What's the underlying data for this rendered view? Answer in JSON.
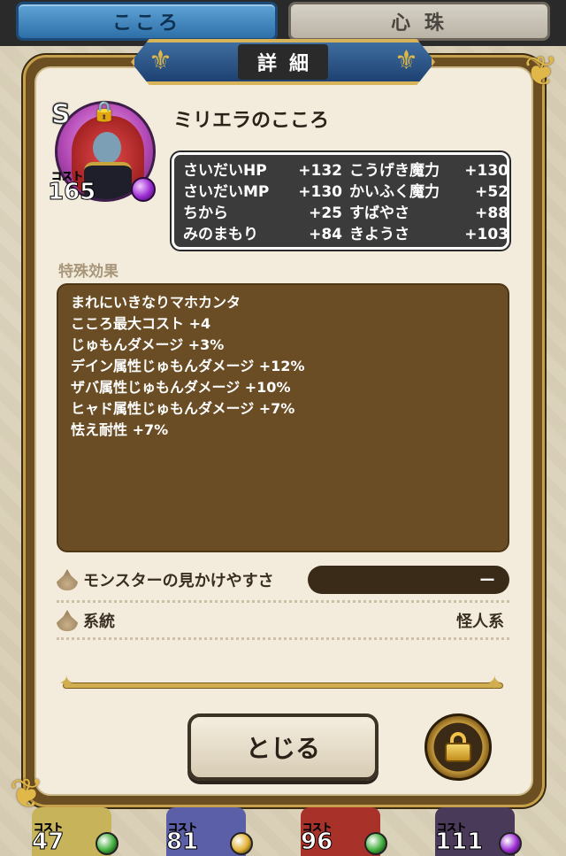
{
  "tabs": [
    {
      "label": "こころ",
      "active": true
    },
    {
      "label": "心 珠",
      "active": false
    }
  ],
  "dialog": {
    "title": "詳細",
    "heart_name": "ミリエラのこころ",
    "rank": "S",
    "cost_label": "コスト",
    "cost_value": "165",
    "stats": [
      {
        "label": "さいだいHP",
        "value": "+132"
      },
      {
        "label": "こうげき魔力",
        "value": "+130"
      },
      {
        "label": "さいだいMP",
        "value": "+130"
      },
      {
        "label": "かいふく魔力",
        "value": "+52"
      },
      {
        "label": "ちから",
        "value": "+25"
      },
      {
        "label": "すばやさ",
        "value": "+88"
      },
      {
        "label": "みのまもり",
        "value": "+84"
      },
      {
        "label": "きようさ",
        "value": "+103"
      }
    ],
    "special_label": "特殊効果",
    "effects": [
      "まれにいきなりマホカンタ",
      "こころ最大コスト +4",
      "じゅもんダメージ +3%",
      "デイン属性じゅもんダメージ +12%",
      "ザバ属性じゅもんダメージ +10%",
      "ヒャド属性じゅもんダメージ +7%",
      "怯え耐性 +7%"
    ],
    "visibility_label": "モンスターの見かけやすさ",
    "visibility_value": "ー",
    "family_label": "系統",
    "family_value": "怪人系",
    "close_label": "とじる"
  },
  "bottom_cards": [
    {
      "cost_label": "コスト",
      "cost": "47",
      "orb_color": "#3fae3a",
      "bg_color": "#c7b45a"
    },
    {
      "cost_label": "コスト",
      "cost": "81",
      "orb_color": "#e0b030",
      "bg_color": "#5b5fa8"
    },
    {
      "cost_label": "コスト",
      "cost": "96",
      "orb_color": "#3fae3a",
      "bg_color": "#a8322a"
    },
    {
      "cost_label": "コスト",
      "cost": "111",
      "orb_color": "#9b2bd3",
      "bg_color": "#4a3a5a"
    }
  ],
  "colors": {
    "tab_active": "#2e6fa8",
    "panel_border": "#c6a04a",
    "stats_bg": "#3b3b3b",
    "effects_bg": "#6a4d24"
  }
}
